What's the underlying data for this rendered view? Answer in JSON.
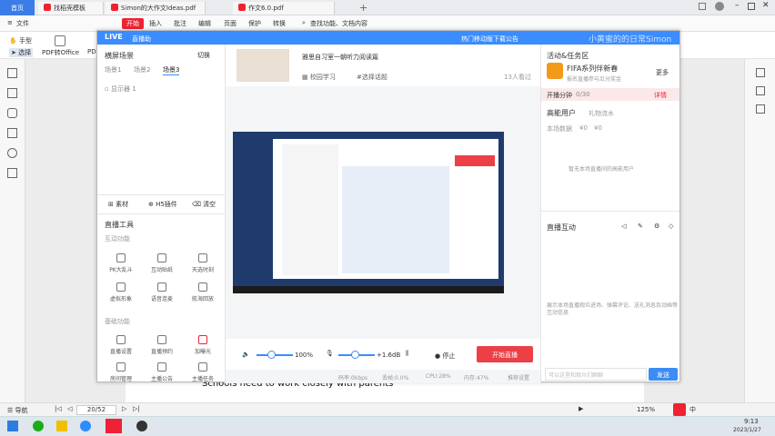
{
  "tabs": [
    {
      "label": "首页",
      "icon": "home-icon"
    },
    {
      "label": "找稻壳模板",
      "icon": "docer-icon"
    },
    {
      "label": "Simon的大作文Ideas.pdf",
      "icon": "pdf-icon"
    },
    {
      "label": "作文6.0.pdf",
      "icon": "pdf-icon"
    }
  ],
  "menu": {
    "file": "文件",
    "items": [
      "开始",
      "插入",
      "批注",
      "编辑",
      "页面",
      "保护",
      "转换"
    ],
    "search": "查找功能、文档内容"
  },
  "toolbar": {
    "hand": "手型",
    "select": "选择",
    "pdf_to_office": "PDF转Office",
    "pd": "PD"
  },
  "live": {
    "title": "直播助",
    "hot_download": "热门移动版下载公告",
    "scene_header": "横屏场景",
    "switch": "切换",
    "scenes": [
      "场景1",
      "场景2",
      "场景3"
    ],
    "display": "显示器 1",
    "bottom_links": [
      "素材",
      "H5插件",
      "清空"
    ],
    "tools_header": "直播工具",
    "interactive_header": "互动功能",
    "interactive_tools": [
      "PK大乱斗",
      "互动贴纸",
      "天选时刻",
      "虚拟形象",
      "语音连麦",
      "航海回放"
    ],
    "basic_header": "基础功能",
    "basic_tools": [
      "直播设置",
      "直播预约",
      "加曝光",
      "房间管理",
      "主播公告",
      "主播任务"
    ],
    "course_title": "雅思自习室一朝听力阅读篇",
    "course_tag1": "校园学习",
    "course_tag2": "#选择话题",
    "course_viewers": "13人看过",
    "vol_percent": "100%",
    "mic_db": "+1.6dB",
    "stop": "停止",
    "start_live": "开始直播",
    "stats": [
      "码率:0kbps",
      "丢帧:0.0%",
      "CPU:28%",
      "内存:47%"
    ],
    "recommend": "推荐设置",
    "activity_header": "活动&任务区",
    "fifa_title": "FIFA系列伴新春",
    "fifa_sub": "报名直播参与瓜分奖金",
    "more": "更多",
    "time_label": "开播分钟",
    "time_value": "0/30",
    "detail": "详情",
    "high_users": "高能用户",
    "gift_flow": "礼物流水",
    "this_data": "本场数据",
    "zero1": "¥0",
    "zero2": "¥0",
    "empty_users": "暂无本场直播间的高能用户",
    "interaction_header": "直播互动",
    "interaction_empty": "展示本场直播观众进场、弹幕评论、送礼消息及动画等互动信息",
    "chat_placeholder": "可以这里和观众们聊聊",
    "send": "发送",
    "watermark": "小黄蜜的的日常Simon"
  },
  "doc_text": "Schools need to work closely with parents",
  "status": {
    "nav": "导航",
    "page": "20/52",
    "zoom": "125%"
  },
  "tray": {
    "time": "9:13",
    "date": "2023/1/27",
    "ime": "中"
  },
  "colors": {
    "accent": "#3a8cff",
    "red": "#ec3f46",
    "wps_blue": "#3a7ce8"
  }
}
